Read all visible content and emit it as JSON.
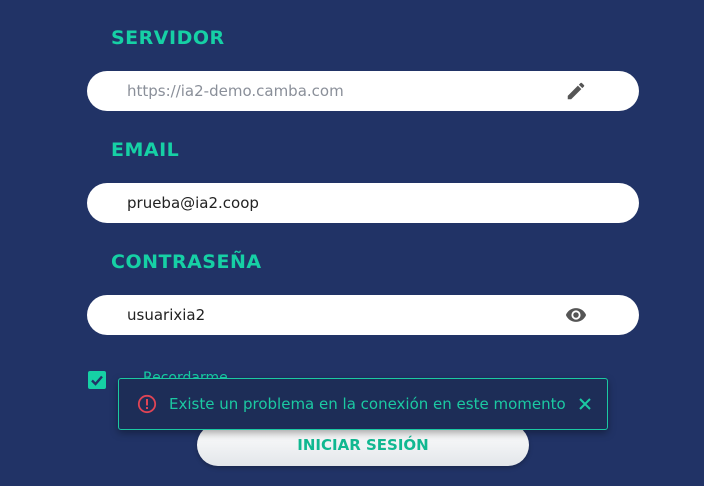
{
  "server": {
    "label": "SERVIDOR",
    "placeholder": "https://ia2-demo.camba.com",
    "icon": "pencil-icon"
  },
  "email": {
    "label": "EMAIL",
    "value": "prueba@ia2.coop"
  },
  "password": {
    "label": "CONTRASEÑA",
    "value": "usuarixia2",
    "icon": "eye-icon"
  },
  "remember": {
    "label": "Recordarme",
    "checked": true
  },
  "login_button": {
    "label": "INICIAR SESIÓN"
  },
  "toast": {
    "message": "Existe un problema en la conexión en este momento",
    "icon": "error-icon",
    "close_icon": "close-icon"
  },
  "colors": {
    "background": "#213366",
    "accent": "#16d0a5",
    "error": "#e04455"
  }
}
